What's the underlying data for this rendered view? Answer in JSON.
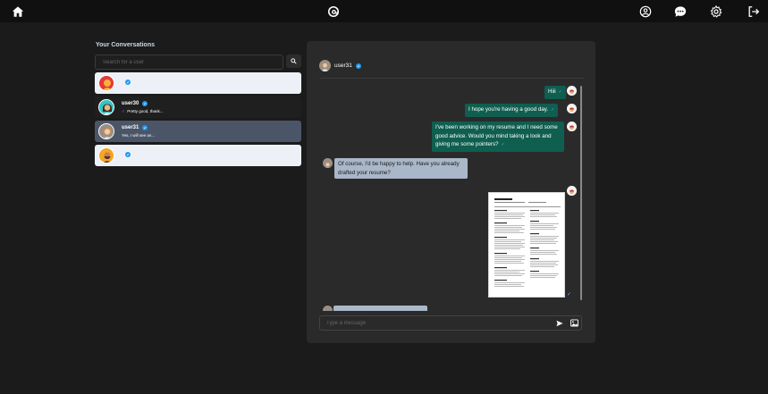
{
  "topbar": {
    "icons": [
      "home-icon",
      "threads-logo-icon",
      "user-circle-icon",
      "chat-bubble-icon",
      "gear-icon",
      "logout-icon"
    ]
  },
  "sidebar": {
    "title": "Your Conversations",
    "search_placeholder": "Search for a user",
    "conversations": [
      {
        "username": "",
        "verified": true,
        "last_message": "",
        "style": "light"
      },
      {
        "username": "user30",
        "verified": true,
        "last_message": "Pretty good, thank...",
        "style": "dark",
        "seen": true
      },
      {
        "username": "user31",
        "verified": true,
        "last_message": "Yes, I will see an...",
        "style": "active"
      },
      {
        "username": "",
        "verified": true,
        "last_message": "",
        "style": "light"
      }
    ]
  },
  "chat": {
    "header_name": "user31",
    "messages": [
      {
        "side": "sent",
        "text": "Hiii"
      },
      {
        "side": "sent",
        "text": "I hope you're having a good day."
      },
      {
        "side": "sent",
        "text": "I've been working on my resume and I need some good advice. Would you mind taking a look and giving me some pointers?"
      },
      {
        "side": "recv",
        "text": "Of course, I'd be happy to help. Have you already drafted your resume?"
      },
      {
        "side": "sent",
        "type": "image",
        "alt": "resume-document"
      }
    ],
    "input_placeholder": "Type a message"
  },
  "colors": {
    "sent_bubble": "#0f5e4f",
    "recv_bubble": "#a9b7c9",
    "active_conv": "#4a5568",
    "verified": "#1d9bf0"
  }
}
